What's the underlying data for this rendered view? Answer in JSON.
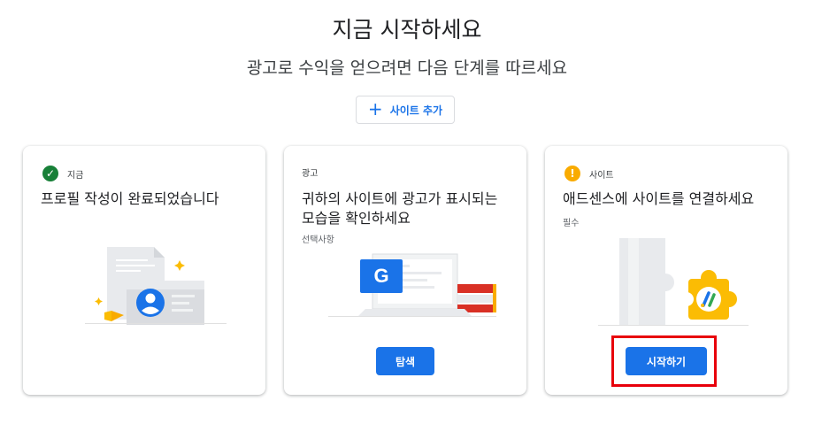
{
  "header": {
    "title": "지금 시작하세요",
    "subtitle": "광고로 수익을 얻으려면 다음 단계를 따르세요",
    "add_site_label": "사이트 추가"
  },
  "cards": [
    {
      "badge": "지금",
      "status": "complete",
      "title": "프로필 작성이 완료되었습니다",
      "illustration": "profile-card-illustration"
    },
    {
      "badge": "광고",
      "title": "귀하의 사이트에 광고가 표시되는 모습을 확인하세요",
      "subtitle": "선택사항",
      "button_label": "탐색",
      "illustration": "google-ad-laptop-illustration"
    },
    {
      "badge": "사이트",
      "status": "required",
      "title": "애드센스에 사이트를 연결하세요",
      "subtitle": "필수",
      "button_label": "시작하기",
      "illustration": "adsense-puzzle-illustration"
    }
  ],
  "colors": {
    "accent": "#1a73e8",
    "success": "#188038",
    "warning": "#f9ab00",
    "highlight": "#e8000b"
  }
}
